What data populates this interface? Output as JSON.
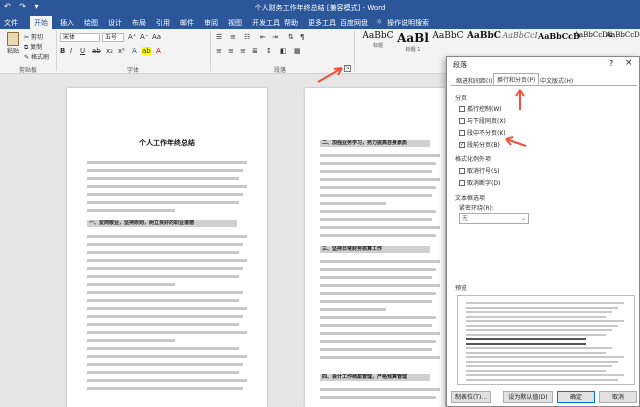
{
  "app": {
    "title": "个人财务工作年终总结 [兼容模式] - Word",
    "quick_access": "↶ ↷ ▾"
  },
  "ribbon": {
    "tabs": [
      {
        "label": "文件"
      },
      {
        "label": "开始"
      },
      {
        "label": "插入"
      },
      {
        "label": "绘图"
      },
      {
        "label": "设计"
      },
      {
        "label": "布局"
      },
      {
        "label": "引用"
      },
      {
        "label": "邮件"
      },
      {
        "label": "审阅"
      },
      {
        "label": "视图"
      },
      {
        "label": "开发工具"
      },
      {
        "label": "帮助"
      },
      {
        "label": "更多工具"
      },
      {
        "label": "百度网盘"
      }
    ],
    "tell_me": "操作说明搜索",
    "clipboard": {
      "paste": "粘贴",
      "cut": "剪切",
      "copy": "复制",
      "format_painter": "格式刷",
      "group_label": "剪贴板"
    },
    "font": {
      "family": "宋体",
      "size": "五号",
      "group_label": "字体",
      "bold": "B",
      "italic": "I",
      "underline": "U"
    },
    "paragraph": {
      "group_label": "段落"
    },
    "styles": [
      {
        "preview": "AaBbC",
        "label": "标题"
      },
      {
        "preview": "AaBl",
        "label": "标题 1"
      },
      {
        "preview": "AaBbC",
        "label": ""
      },
      {
        "preview": "AaBbC",
        "label": ""
      },
      {
        "preview": "AaBbCcI",
        "label": ""
      },
      {
        "preview": "AaBbCcD",
        "label": ""
      },
      {
        "preview": "AaBbCcDd",
        "label": ""
      },
      {
        "preview": "AaBbCcDd",
        "label": ""
      }
    ]
  },
  "document": {
    "left_title": "个人工作年终总结",
    "left_heading1": "一、爱岗敬业，坚持原则，树立良好的职业道德",
    "left_heading2": "二、加强业务学习，努力提高自身素质",
    "right_heading1": "二、加强业务学习，努力提高自身素质",
    "right_heading2": "三、坚持日常财务核算工作",
    "right_heading3": "四、会计工作档案管理，严格预算管理"
  },
  "dialog": {
    "title": "段落",
    "help": "?",
    "close": "×",
    "tabs": [
      {
        "label": "缩进和间距(I)"
      },
      {
        "label": "换行和分页(P)"
      },
      {
        "label": "中文版式(H)"
      }
    ],
    "section_pagination": "分页",
    "options": [
      {
        "label": "孤行控制(W)",
        "checked": false
      },
      {
        "label": "与下段同页(X)",
        "checked": false
      },
      {
        "label": "段中不分页(K)",
        "checked": false
      },
      {
        "label": "段前分页(B)",
        "checked": true
      }
    ],
    "section_format": "格式化例外项",
    "format_options": [
      {
        "label": "取消行号(S)",
        "checked": false
      },
      {
        "label": "取消断字(D)",
        "checked": false
      }
    ],
    "section_textbox": "文本框选项",
    "tight_wrap_label": "紧密环绕(R):",
    "tight_wrap_value": "无",
    "section_preview": "预览",
    "buttons": {
      "tabs": "制表位(T)...",
      "default": "设为默认值(D)",
      "ok": "确定",
      "cancel": "取消"
    }
  },
  "colors": {
    "accent": "#2b579a",
    "annotation_arrow": "#f0503a"
  }
}
